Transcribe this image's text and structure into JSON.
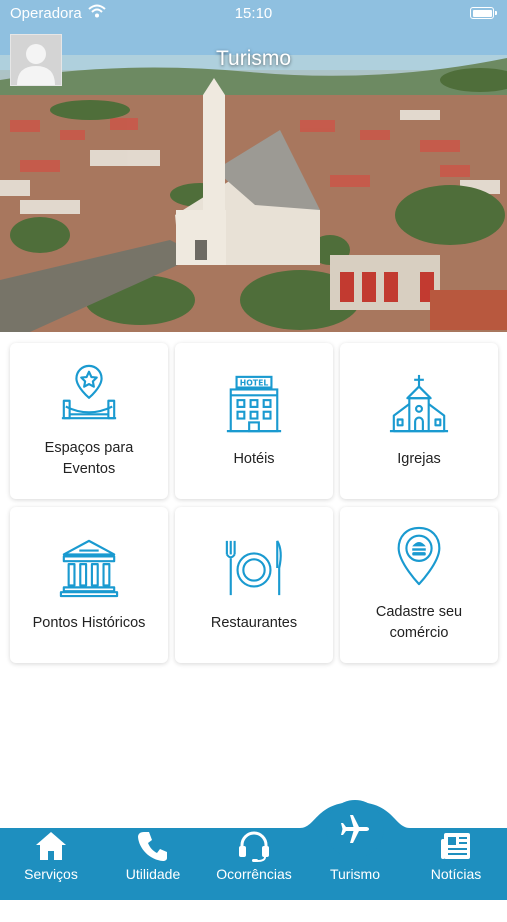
{
  "status_bar": {
    "carrier": "Operadora",
    "time": "15:10"
  },
  "header": {
    "title": "Turismo",
    "avatar_icon": "user-avatar-placeholder"
  },
  "colors": {
    "accent": "#1e8fbf",
    "icon_blue": "#1a9ad0",
    "card_text": "#222222"
  },
  "cards": [
    {
      "label": "Espaços para Eventos",
      "icon": "event-stage-icon"
    },
    {
      "label": "Hotéis",
      "icon": "hotel-icon"
    },
    {
      "label": "Igrejas",
      "icon": "church-icon"
    },
    {
      "label": "Pontos Históricos",
      "icon": "museum-icon"
    },
    {
      "label": "Restaurantes",
      "icon": "restaurant-icon"
    },
    {
      "label": "Cadastre seu comércio",
      "icon": "location-pin-icon"
    }
  ],
  "bottom_nav": {
    "items": [
      {
        "label": "Serviços",
        "icon": "home-icon"
      },
      {
        "label": "Utilidade",
        "icon": "phone-icon"
      },
      {
        "label": "Ocorrências",
        "icon": "headset-icon"
      },
      {
        "label": "Turismo",
        "icon": "airplane-icon",
        "active": true
      },
      {
        "label": "Notícias",
        "icon": "newspaper-icon"
      }
    ]
  }
}
